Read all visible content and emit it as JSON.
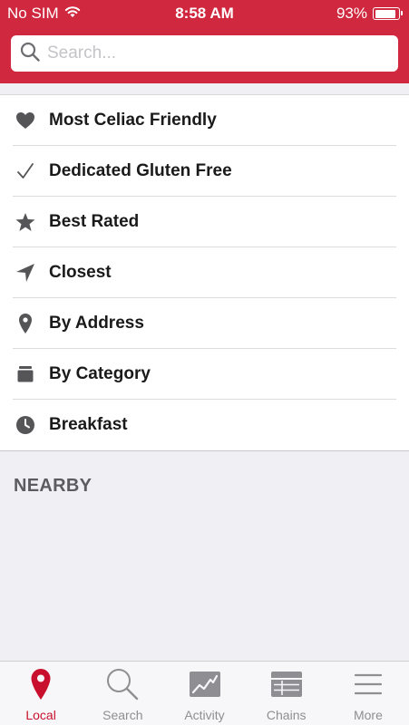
{
  "status_bar": {
    "carrier": "No SIM",
    "time": "8:58 AM",
    "battery": "93%"
  },
  "search": {
    "placeholder": "Search..."
  },
  "menu": {
    "items": [
      {
        "label": "Most Celiac Friendly",
        "icon": "heart-icon"
      },
      {
        "label": "Dedicated Gluten Free",
        "icon": "checkmark-icon"
      },
      {
        "label": "Best Rated",
        "icon": "star-icon"
      },
      {
        "label": "Closest",
        "icon": "location-arrow-icon"
      },
      {
        "label": "By Address",
        "icon": "map-pin-icon"
      },
      {
        "label": "By Category",
        "icon": "category-box-icon"
      },
      {
        "label": "Breakfast",
        "icon": "clock-icon"
      }
    ]
  },
  "nearby": {
    "title": "NEARBY"
  },
  "tabbar": {
    "tabs": [
      {
        "label": "Local",
        "icon": "map-pin-icon",
        "active": true
      },
      {
        "label": "Search",
        "icon": "magnifier-icon",
        "active": false
      },
      {
        "label": "Activity",
        "icon": "activity-chart-icon",
        "active": false
      },
      {
        "label": "Chains",
        "icon": "table-icon",
        "active": false
      },
      {
        "label": "More",
        "icon": "hamburger-icon",
        "active": false
      }
    ]
  },
  "colors": {
    "header": "#d0283e",
    "active_tab": "#c8102e",
    "inactive_tab": "#8e8e93",
    "background": "#efeff4"
  }
}
